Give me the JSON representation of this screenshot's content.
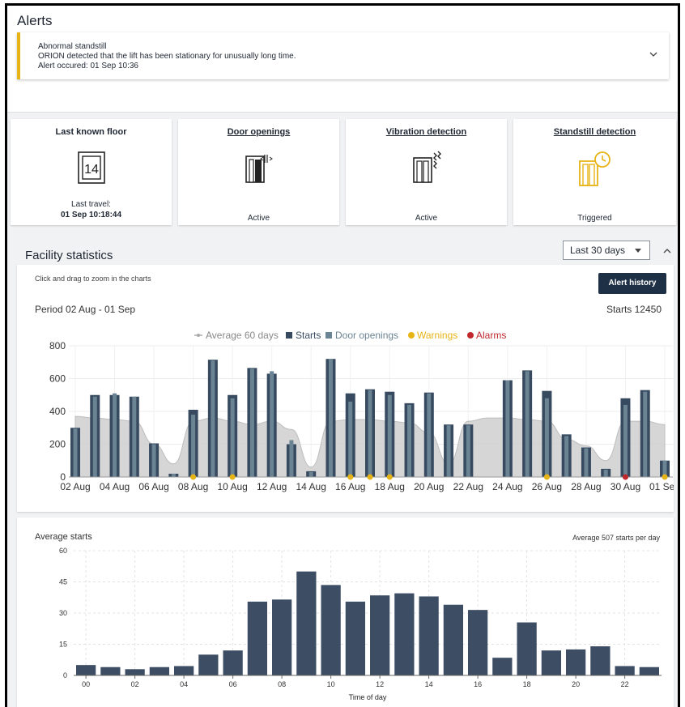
{
  "alerts": {
    "title": "Alerts",
    "items": [
      {
        "title": "Abnormal standstill",
        "message": "ORION detected that the lift has been stationary for unusually long time.",
        "occurred": "Alert occured: 01 Sep 10:36",
        "severity_color": "#e7b416"
      }
    ]
  },
  "status_cards": {
    "floor": {
      "title": "Last known floor",
      "floor_value": "14",
      "sub_label": "Last travel:",
      "sub_value": "01 Sep 10:18:44",
      "icon": "elevator-floor-icon"
    },
    "door": {
      "title": "Door openings",
      "status": "Active",
      "icon": "door-opening-icon"
    },
    "vibration": {
      "title": "Vibration detection",
      "status": "Active",
      "icon": "vibration-icon"
    },
    "standstill": {
      "title": "Standstill detection",
      "status": "Triggered",
      "icon": "standstill-clock-icon",
      "accent": "#e7b416"
    }
  },
  "facility": {
    "title": "Facility statistics",
    "range": "Last 30 days",
    "hint": "Click and drag to zoom in the charts",
    "alert_history_label": "Alert history",
    "period": "Period 02 Aug - 01 Sep",
    "starts_total": "Starts 12450"
  },
  "average": {
    "title": "Average starts",
    "summary": "Average 507 starts per day"
  },
  "chart_data": [
    {
      "type": "bar",
      "legend": [
        "Average 60 days",
        "Starts",
        "Door openings",
        "Warnings",
        "Alarms"
      ],
      "colors": {
        "average": "#cfcfcf",
        "starts": "#374a5f",
        "door": "#6b8493",
        "warnings": "#e7b416",
        "alarms": "#c0282d"
      },
      "categories": [
        "02 Aug",
        "03 Aug",
        "04 Aug",
        "05 Aug",
        "06 Aug",
        "07 Aug",
        "08 Aug",
        "09 Aug",
        "10 Aug",
        "11 Aug",
        "12 Aug",
        "13 Aug",
        "14 Aug",
        "15 Aug",
        "16 Aug",
        "17 Aug",
        "18 Aug",
        "19 Aug",
        "20 Aug",
        "21 Aug",
        "22 Aug",
        "23 Aug",
        "24 Aug",
        "25 Aug",
        "26 Aug",
        "27 Aug",
        "28 Aug",
        "29 Aug",
        "30 Aug",
        "31 Aug",
        "01 Sep"
      ],
      "xticks": [
        "02 Aug",
        "04 Aug",
        "06 Aug",
        "08 Aug",
        "10 Aug",
        "12 Aug",
        "14 Aug",
        "16 Aug",
        "18 Aug",
        "20 Aug",
        "22 Aug",
        "24 Aug",
        "26 Aug",
        "28 Aug",
        "30 Aug",
        "01 Sep"
      ],
      "ylim": [
        0,
        800
      ],
      "yticks": [
        0,
        200,
        400,
        600,
        800
      ],
      "series": [
        {
          "name": "Starts",
          "values": [
            300,
            500,
            500,
            490,
            205,
            20,
            410,
            715,
            500,
            665,
            630,
            200,
            35,
            720,
            510,
            535,
            520,
            450,
            515,
            320,
            320,
            null,
            590,
            650,
            525,
            260,
            180,
            50,
            480,
            530,
            100
          ]
        },
        {
          "name": "Door openings",
          "values": [
            295,
            490,
            510,
            490,
            200,
            20,
            380,
            710,
            480,
            660,
            645,
            225,
            30,
            720,
            460,
            530,
            500,
            440,
            510,
            315,
            315,
            null,
            590,
            645,
            480,
            250,
            175,
            45,
            440,
            520,
            100
          ]
        },
        {
          "name": "Average 60 days",
          "values": [
            370,
            360,
            350,
            340,
            200,
            80,
            340,
            360,
            340,
            320,
            340,
            290,
            60,
            340,
            350,
            350,
            340,
            330,
            270,
            80,
            340,
            360,
            360,
            350,
            340,
            230,
            190,
            100,
            340,
            340,
            320
          ]
        },
        {
          "name": "Warnings",
          "dates": [
            "08 Aug",
            "10 Aug",
            "16 Aug",
            "17 Aug",
            "18 Aug",
            "26 Aug",
            "01 Sep"
          ]
        },
        {
          "name": "Alarms",
          "dates": [
            "30 Aug"
          ]
        }
      ]
    },
    {
      "type": "bar",
      "xlabel": "Time of day",
      "categories": [
        "00",
        "01",
        "02",
        "03",
        "04",
        "05",
        "06",
        "07",
        "08",
        "09",
        "10",
        "11",
        "12",
        "13",
        "14",
        "15",
        "16",
        "17",
        "18",
        "19",
        "20",
        "21",
        "22",
        "23"
      ],
      "xticks": [
        "00",
        "02",
        "04",
        "06",
        "08",
        "10",
        "12",
        "14",
        "16",
        "18",
        "20",
        "22"
      ],
      "values": [
        5,
        4,
        3,
        4,
        4.5,
        10,
        12,
        35.5,
        36.5,
        50,
        43.5,
        35.5,
        38.5,
        39.5,
        38,
        34,
        31.5,
        8.5,
        25.5,
        12,
        12.5,
        14,
        4.5,
        4
      ],
      "ylim": [
        0,
        60
      ],
      "yticks": [
        0,
        15,
        30,
        45,
        60
      ],
      "color": "#3d4d63"
    }
  ]
}
